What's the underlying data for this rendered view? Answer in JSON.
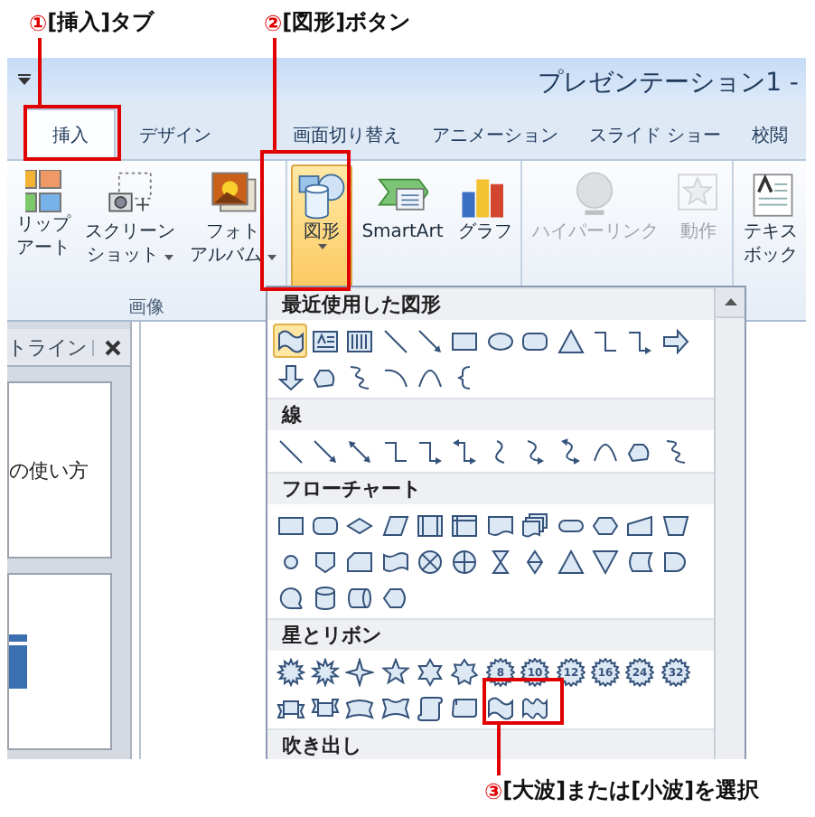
{
  "annotations": [
    {
      "number": "①",
      "label": "[挿入]タブ"
    },
    {
      "number": "②",
      "label": "[図形]ボタン"
    },
    {
      "number": "③",
      "label": "[大波]または[小波]を選択"
    }
  ],
  "window": {
    "title": "プレゼンテーション1 -"
  },
  "tabs": [
    {
      "label": "挿入",
      "selected": true
    },
    {
      "label": "デザイン",
      "selected": false
    },
    {
      "label": "画面切り替え",
      "selected": false
    },
    {
      "label": "アニメーション",
      "selected": false
    },
    {
      "label": "スライド ショー",
      "selected": false
    },
    {
      "label": "校閲",
      "selected": false
    }
  ],
  "ribbon": {
    "groups": [
      {
        "label": "画像",
        "buttons": [
          {
            "kind": "clipart",
            "lines": [
              "リップ",
              "アート"
            ],
            "dropdown": false,
            "selected": false,
            "disabled": false
          },
          {
            "kind": "screenshot",
            "lines": [
              "スクリーン",
              "ショット"
            ],
            "dropdown": true,
            "selected": false,
            "disabled": false
          },
          {
            "kind": "photo-album",
            "lines": [
              "フォト",
              "アルバム"
            ],
            "dropdown": true,
            "selected": false,
            "disabled": false
          }
        ]
      },
      {
        "buttons": [
          {
            "kind": "shapes",
            "lines": [
              "図形"
            ],
            "dropdown": true,
            "selected": true,
            "disabled": false
          },
          {
            "kind": "smartart",
            "lines": [
              "SmartArt"
            ],
            "dropdown": false,
            "selected": false,
            "disabled": false
          },
          {
            "kind": "chart",
            "lines": [
              "グラフ"
            ],
            "dropdown": false,
            "selected": false,
            "disabled": false
          }
        ]
      },
      {
        "buttons": [
          {
            "kind": "hyperlink",
            "lines": [
              "ハイパーリンク"
            ],
            "dropdown": false,
            "selected": false,
            "disabled": true
          },
          {
            "kind": "action",
            "lines": [
              "動作"
            ],
            "dropdown": false,
            "selected": false,
            "disabled": true
          }
        ]
      },
      {
        "buttons": [
          {
            "kind": "textbox",
            "lines": [
              "テキス",
              "ボック"
            ],
            "dropdown": false,
            "selected": false,
            "disabled": false
          }
        ]
      }
    ]
  },
  "outline_pane": {
    "tab": "トライン",
    "slides": [
      {
        "kind": "text",
        "text": "の使い方"
      },
      {
        "kind": "image"
      }
    ]
  },
  "gallery": {
    "sections": [
      {
        "title": "最近使用した図形",
        "shapes": [
          {
            "kind": "wave",
            "selected": true
          },
          {
            "kind": "textbox",
            "selected": false
          },
          {
            "kind": "vertical-textbox",
            "selected": false
          },
          {
            "kind": "line",
            "selected": false
          },
          {
            "kind": "arrow-line",
            "selected": false
          },
          {
            "kind": "rect",
            "selected": false
          },
          {
            "kind": "ellipse",
            "selected": false
          },
          {
            "kind": "round-rect",
            "selected": false
          },
          {
            "kind": "triangle",
            "selected": false
          },
          {
            "kind": "elbow",
            "selected": false
          },
          {
            "kind": "elbow-arrow",
            "selected": false
          },
          {
            "kind": "right-arrow",
            "selected": false
          },
          {
            "kind": "down-arrow",
            "selected": false
          },
          {
            "kind": "freeform",
            "selected": false
          },
          {
            "kind": "scribble",
            "selected": false
          },
          {
            "kind": "arc",
            "selected": false
          },
          {
            "kind": "curve",
            "selected": false
          },
          {
            "kind": "brace",
            "selected": false
          }
        ]
      },
      {
        "title": "線",
        "shapes": [
          {
            "kind": "line",
            "selected": false
          },
          {
            "kind": "arrow-line",
            "selected": false
          },
          {
            "kind": "double-arrow",
            "selected": false
          },
          {
            "kind": "elbow",
            "selected": false
          },
          {
            "kind": "elbow-arrow",
            "selected": false
          },
          {
            "kind": "elbow-double-arrow",
            "selected": false
          },
          {
            "kind": "s-curve",
            "selected": false
          },
          {
            "kind": "s-curve-arrow",
            "selected": false
          },
          {
            "kind": "s-curve-double-arrow",
            "selected": false
          },
          {
            "kind": "curve",
            "selected": false
          },
          {
            "kind": "freeform",
            "selected": false
          },
          {
            "kind": "scribble",
            "selected": false
          }
        ]
      },
      {
        "title": "フローチャート",
        "shapes": [
          {
            "kind": "rect",
            "selected": false
          },
          {
            "kind": "round-rect",
            "selected": false
          },
          {
            "kind": "diamond",
            "selected": false
          },
          {
            "kind": "parallelogram",
            "selected": false
          },
          {
            "kind": "predefined-process",
            "selected": false
          },
          {
            "kind": "internal-storage",
            "selected": false
          },
          {
            "kind": "document",
            "selected": false
          },
          {
            "kind": "multidocument",
            "selected": false
          },
          {
            "kind": "terminator",
            "selected": false
          },
          {
            "kind": "hexagon",
            "selected": false
          },
          {
            "kind": "manual-input",
            "selected": false
          },
          {
            "kind": "manual-operation",
            "selected": false
          },
          {
            "kind": "circle",
            "selected": false
          },
          {
            "kind": "off-page",
            "selected": false
          },
          {
            "kind": "card",
            "selected": false
          },
          {
            "kind": "punched-tape",
            "selected": false
          },
          {
            "kind": "summing-junction",
            "selected": false
          },
          {
            "kind": "or",
            "selected": false
          },
          {
            "kind": "collate",
            "selected": false
          },
          {
            "kind": "sort",
            "selected": false
          },
          {
            "kind": "triangle",
            "selected": false
          },
          {
            "kind": "inverted-triangle",
            "selected": false
          },
          {
            "kind": "stored-data",
            "selected": false
          },
          {
            "kind": "delay",
            "selected": false
          },
          {
            "kind": "sequential-access",
            "selected": false
          },
          {
            "kind": "cylinder",
            "selected": false
          },
          {
            "kind": "direct-access",
            "selected": false
          },
          {
            "kind": "display",
            "selected": false
          }
        ]
      },
      {
        "title": "星とリボン",
        "shapes": [
          {
            "kind": "explosion",
            "selected": false
          },
          {
            "kind": "explosion-2",
            "selected": false
          },
          {
            "kind": "star-4",
            "selected": false
          },
          {
            "kind": "star-5",
            "selected": false
          },
          {
            "kind": "star-6",
            "selected": false
          },
          {
            "kind": "star-7",
            "selected": false
          },
          {
            "kind": "seal",
            "label": "8",
            "selected": false
          },
          {
            "kind": "seal",
            "label": "10",
            "selected": false
          },
          {
            "kind": "seal",
            "label": "12",
            "selected": false
          },
          {
            "kind": "seal",
            "label": "16",
            "selected": false
          },
          {
            "kind": "seal",
            "label": "24",
            "selected": false
          },
          {
            "kind": "seal",
            "label": "32",
            "selected": false
          },
          {
            "kind": "ribbon-down",
            "selected": false
          },
          {
            "kind": "ribbon-up",
            "selected": false
          },
          {
            "kind": "curved-ribbon-down",
            "selected": false
          },
          {
            "kind": "curved-ribbon-up",
            "selected": false
          },
          {
            "kind": "vertical-scroll",
            "selected": false
          },
          {
            "kind": "horizontal-scroll",
            "selected": false
          },
          {
            "kind": "wave",
            "selected": false
          },
          {
            "kind": "double-wave",
            "selected": false
          }
        ]
      },
      {
        "title": "吹き出し"
      }
    ]
  }
}
